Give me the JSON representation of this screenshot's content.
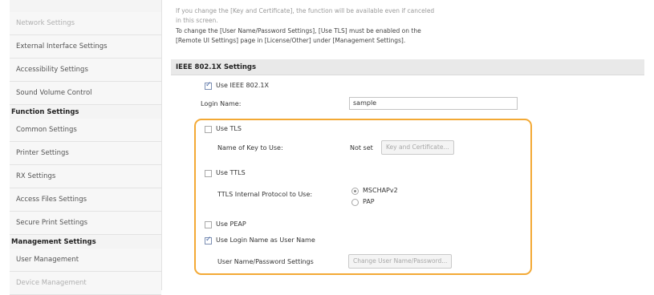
{
  "sidebar": {
    "items_top": [
      {
        "label": "Network Settings"
      },
      {
        "label": "External Interface Settings"
      },
      {
        "label": "Accessibility Settings"
      },
      {
        "label": "Sound Volume Control"
      }
    ],
    "function_header": "Function Settings",
    "function_items": [
      {
        "label": "Common Settings"
      },
      {
        "label": "Printer Settings"
      },
      {
        "label": "RX Settings"
      },
      {
        "label": "Access Files Settings"
      },
      {
        "label": "Secure Print Settings"
      }
    ],
    "management_header": "Management Settings",
    "management_items": [
      {
        "label": "User Management"
      },
      {
        "label": "Device Management"
      }
    ]
  },
  "notes": {
    "line1": "If you change the [Key and Certificate], the function will be available even if canceled",
    "line2": "in this screen.",
    "line3": "To change the [User Name/Password Settings], [Use TLS] must be enabled on the",
    "line4": "[Remote UI Settings] page in [License/Other] under [Management Settings]."
  },
  "section": {
    "title": "IEEE 802.1X Settings",
    "use_ieee_label": "Use IEEE 802.1X",
    "use_ieee_checked": true,
    "login_name_label": "Login Name:",
    "login_name_value": "sample",
    "use_tls_label": "Use TLS",
    "use_tls_checked": false,
    "key_label": "Name of Key to Use:",
    "key_value": "Not set",
    "key_button": "Key and Certificate...",
    "use_ttls_label": "Use TTLS",
    "use_ttls_checked": false,
    "ttls_protocol_label": "TTLS Internal Protocol to Use:",
    "ttls_options": [
      "MSCHAPv2",
      "PAP"
    ],
    "ttls_selected": "MSCHAPv2",
    "use_peap_label": "Use PEAP",
    "use_peap_checked": false,
    "use_login_as_user_label": "Use Login Name as User Name",
    "use_login_as_user_checked": true,
    "user_pw_label": "User Name/Password Settings",
    "user_pw_button": "Change User Name/Password..."
  },
  "colors": {
    "highlight": "#f3a935",
    "section_bar": "#e9e9e9",
    "sidebar_bg": "#f4f4f4"
  }
}
